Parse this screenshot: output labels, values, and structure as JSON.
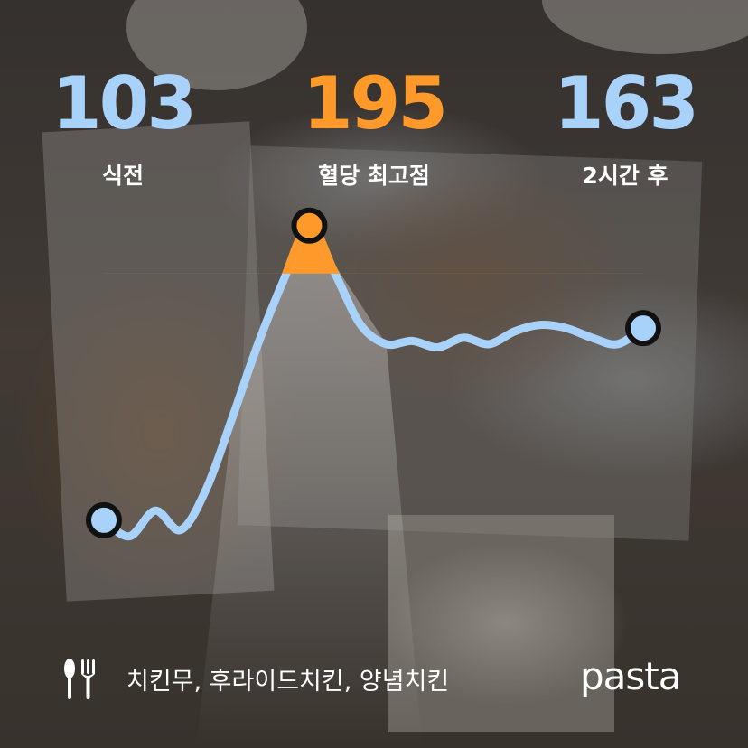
{
  "header": {
    "before": {
      "value": "103",
      "label": "식전"
    },
    "peak": {
      "value": "195",
      "label": "혈당 최고점"
    },
    "after": {
      "value": "163",
      "label": "2시간 후"
    }
  },
  "colors": {
    "line": "#a9d2fb",
    "peak_fill": "#ff9a2a",
    "marker_fill": "#a9d2fb",
    "marker_stroke": "#111111",
    "text": "#ffffff"
  },
  "footer": {
    "icon": "fork-knife-icon",
    "foods": "치킨무, 후라이드치킨, 양념치킨",
    "brand": "pasta"
  },
  "chart_data": {
    "type": "line",
    "series": [
      {
        "values": [
          103,
          98,
          106,
          100,
          113,
          135,
          158,
          178,
          195,
          180,
          164,
          158,
          159,
          157,
          160,
          158,
          162,
          164,
          163,
          160,
          158,
          163
        ]
      }
    ],
    "ylim": [
      90,
      200
    ],
    "markers": [
      {
        "index": 0,
        "value": 103
      },
      {
        "index": 8,
        "value": 195
      },
      {
        "index": 21,
        "value": 163
      }
    ],
    "highlight_threshold": 180
  }
}
